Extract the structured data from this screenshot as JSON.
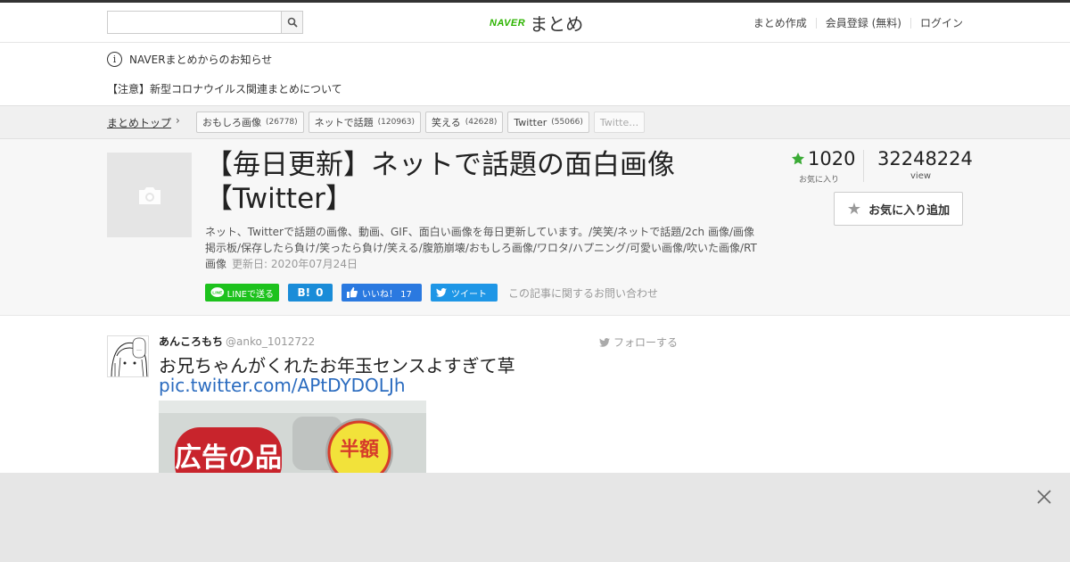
{
  "header": {
    "search_placeholder": "",
    "logo_brand": "NAVER",
    "logo_text": "まとめ",
    "nav": [
      "まとめ作成",
      "会員登録 (無料)",
      "ログイン"
    ]
  },
  "notice": {
    "title": "NAVERまとめからのお知らせ",
    "item": "【注意】新型コロナウイルス関連まとめについて"
  },
  "breadcrumb": {
    "top": "まとめトップ",
    "tags": [
      {
        "label": "おもしろ画像",
        "count": "(26778)"
      },
      {
        "label": "ネットで話題",
        "count": "(120963)"
      },
      {
        "label": "笑える",
        "count": "(42628)"
      },
      {
        "label": "Twitter",
        "count": "(55066)"
      },
      {
        "label": "Twitte…",
        "count": ""
      }
    ]
  },
  "article": {
    "title_line1": "【毎日更新】ネットで話題の面白画像",
    "title_line2": "【Twitter】",
    "description": "ネット、Twitterで話題の画像、動画、GIF、面白い画像を毎日更新しています。/笑笑/ネットで話題/2ch 画像/画像掲示板/保存したら負け/笑ったら負け/笑える/腹筋崩壊/おもしろ画像/ワロタ/ハプニング/可愛い画像/吹いた画像/RT画像",
    "updated": "更新日: 2020年07月24日",
    "share": {
      "line": "LINEで送る",
      "hatena": "0",
      "fb": "いいね！ 17",
      "tw": "ツイート",
      "inquiry": "この記事に関するお問い合わせ"
    }
  },
  "stats": {
    "favorites": "1020",
    "favorites_label": "お気に入り",
    "views": "32248224",
    "views_label": "view",
    "fav_button": "お気に入り追加"
  },
  "tweet": {
    "name": "あんころもち",
    "handle": "@anko_1012722",
    "follow": "フォローする",
    "text": "お兄ちゃんがくれたお年玉センスよすぎて草",
    "link": "pic.twitter.com/APtDYDOLJh",
    "image_text_left": "広告の品",
    "image_text_right": "半額"
  },
  "colors": {
    "brand_green": "#2db400",
    "link_blue": "#2a6bbf",
    "star_green": "#3bab36"
  }
}
